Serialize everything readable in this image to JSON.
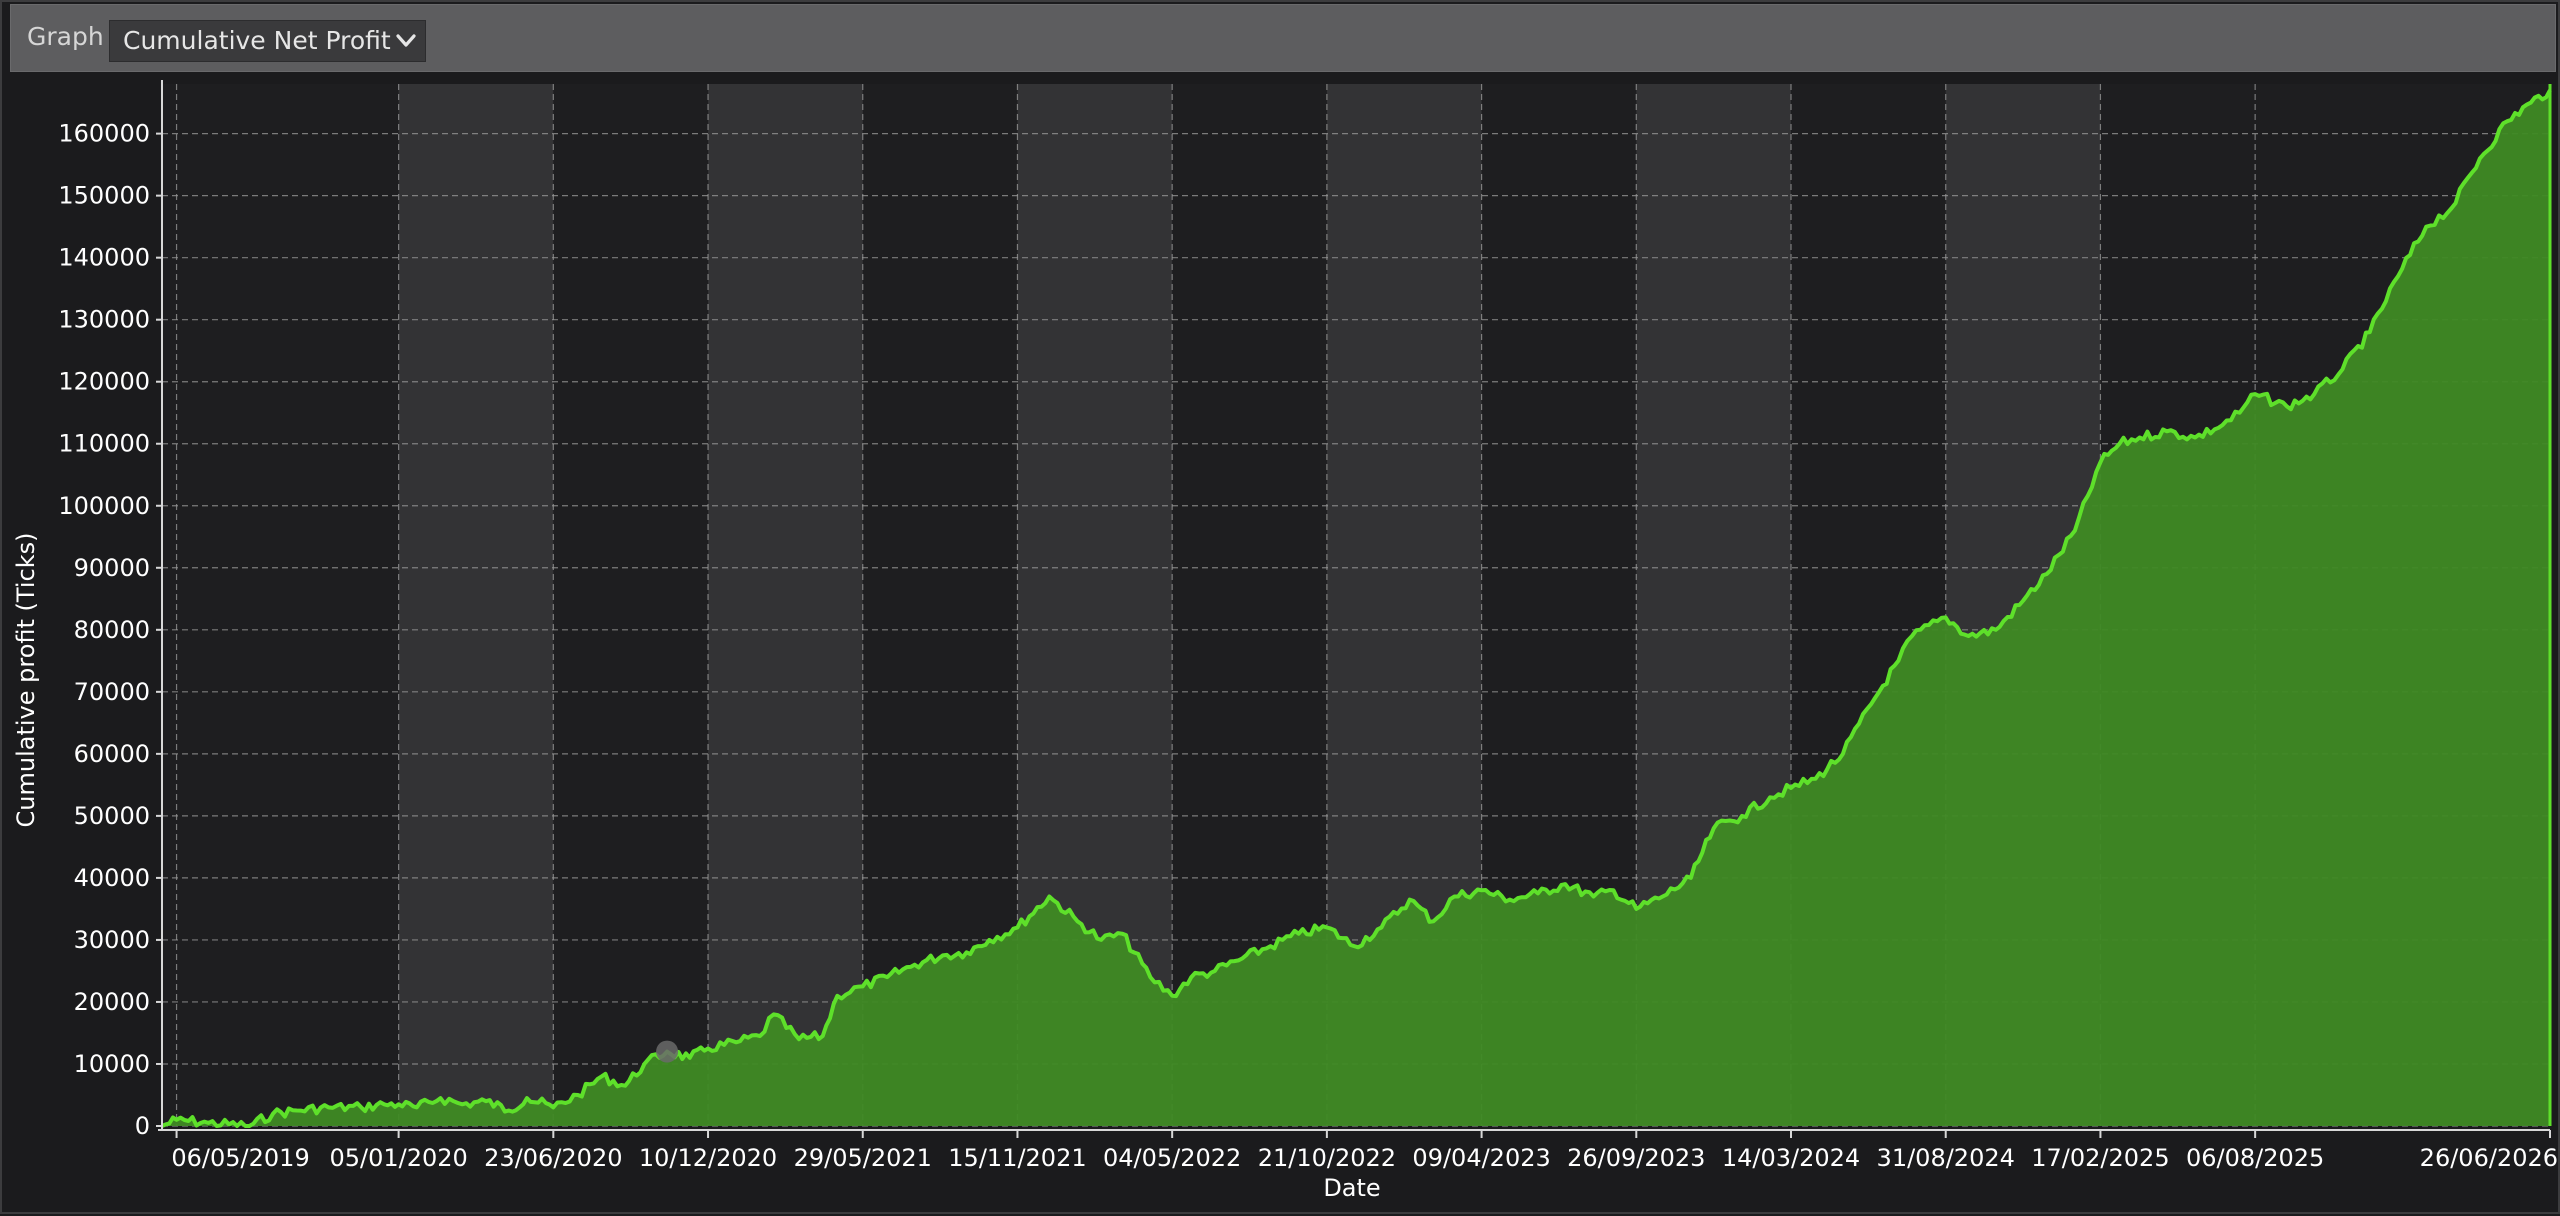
{
  "toolbar": {
    "graph_label": "Graph",
    "selected_graph": "Cumulative Net Profit",
    "chevron_icon": "chevron-down-icon"
  },
  "colors": {
    "background": "#1b1b1d",
    "band_dark": "#1e1e20",
    "band_light": "#333335",
    "fill": "#3f8a24",
    "line": "#5ee02a",
    "grid": "#9a9a9a",
    "text": "#ffffff"
  },
  "chart_data": {
    "type": "area",
    "xlabel": "Date",
    "ylabel": "Cumulative profit (Ticks)",
    "ylim": [
      0,
      168000
    ],
    "yticks": [
      0,
      10000,
      20000,
      30000,
      40000,
      50000,
      60000,
      70000,
      80000,
      90000,
      100000,
      110000,
      120000,
      130000,
      140000,
      150000,
      160000
    ],
    "xlim": [
      "2019-04-20",
      "2026-06-26"
    ],
    "xticks": [
      "06/05/2019",
      "05/01/2020",
      "23/06/2020",
      "10/12/2020",
      "29/05/2021",
      "15/11/2021",
      "04/05/2022",
      "21/10/2022",
      "09/04/2023",
      "26/09/2023",
      "14/03/2024",
      "31/08/2024",
      "17/02/2025",
      "06/08/2025",
      "26/06/2026"
    ],
    "grid": true,
    "highlight_point": {
      "x": "2020-10-26",
      "y": 12000
    },
    "series": [
      {
        "x": [
          "2019-04-20",
          "2019-05-06",
          "2019-06-10",
          "2019-07-25",
          "2019-08-20",
          "2019-09-15",
          "2019-10-20",
          "2019-11-25",
          "2019-12-20",
          "2020-01-05",
          "2020-01-25",
          "2020-02-20",
          "2020-03-15",
          "2020-04-10",
          "2020-05-05",
          "2020-05-25",
          "2020-06-23",
          "2020-07-20",
          "2020-08-15",
          "2020-09-10",
          "2020-10-01",
          "2020-10-26",
          "2020-11-20",
          "2020-12-10",
          "2021-01-10",
          "2021-02-05",
          "2021-02-20",
          "2021-03-20",
          "2021-04-15",
          "2021-05-01",
          "2021-05-29",
          "2021-06-25",
          "2021-07-25",
          "2021-08-25",
          "2021-09-20",
          "2021-10-15",
          "2021-11-15",
          "2021-12-20",
          "2022-01-20",
          "2022-02-15",
          "2022-03-10",
          "2022-04-10",
          "2022-05-04",
          "2022-05-25",
          "2022-06-20",
          "2022-07-20",
          "2022-08-20",
          "2022-09-20",
          "2022-10-21",
          "2022-11-20",
          "2022-12-20",
          "2023-01-20",
          "2023-02-15",
          "2023-03-10",
          "2023-04-09",
          "2023-05-10",
          "2023-06-10",
          "2023-07-10",
          "2023-08-10",
          "2023-09-01",
          "2023-09-26",
          "2023-10-25",
          "2023-11-25",
          "2023-12-20",
          "2024-01-20",
          "2024-02-20",
          "2024-03-14",
          "2024-04-10",
          "2024-05-10",
          "2024-06-10",
          "2024-07-10",
          "2024-07-25",
          "2024-08-31",
          "2024-09-25",
          "2024-10-25",
          "2024-11-20",
          "2024-12-20",
          "2025-01-20",
          "2025-02-17",
          "2025-03-10",
          "2025-04-01",
          "2025-05-01",
          "2025-06-01",
          "2025-07-01",
          "2025-07-20",
          "2025-08-06",
          "2025-09-10",
          "2025-10-10",
          "2025-11-10",
          "2025-12-10",
          "2026-01-10",
          "2026-02-10",
          "2026-03-10",
          "2026-04-10",
          "2026-05-10",
          "2026-06-05",
          "2026-06-26"
        ],
        "values": [
          0,
          1000,
          500,
          0,
          2000,
          2500,
          3000,
          3000,
          3500,
          3500,
          3000,
          4500,
          3500,
          4000,
          2500,
          4500,
          3000,
          5000,
          8000,
          6500,
          10000,
          12000,
          11000,
          12500,
          13500,
          14500,
          18000,
          14000,
          14500,
          21000,
          22500,
          24000,
          26000,
          27500,
          28000,
          30000,
          32000,
          37000,
          33000,
          30000,
          31000,
          24000,
          21000,
          24000,
          25000,
          27000,
          29000,
          31000,
          32000,
          29000,
          32000,
          36500,
          33000,
          37000,
          38000,
          36500,
          37500,
          39000,
          37000,
          38000,
          35000,
          37000,
          40000,
          48000,
          50000,
          53000,
          54500,
          56000,
          60000,
          68000,
          75000,
          79000,
          82000,
          79000,
          80000,
          84000,
          89000,
          96000,
          107000,
          110000,
          111000,
          112000,
          111000,
          113000,
          115000,
          118000,
          116000,
          118000,
          122000,
          128000,
          137000,
          145000,
          148000,
          156000,
          162000,
          165000,
          167000
        ]
      }
    ]
  }
}
